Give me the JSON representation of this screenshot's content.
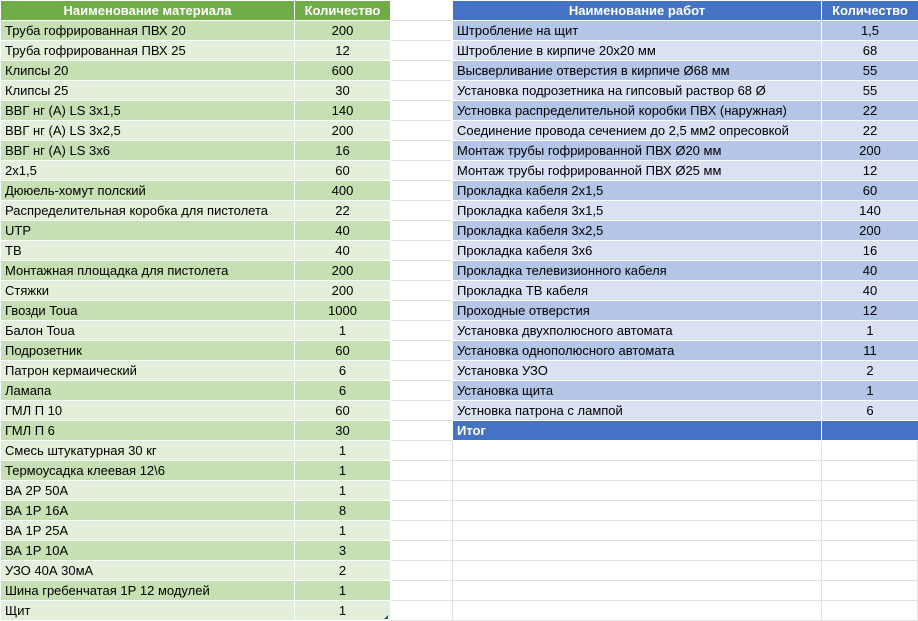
{
  "materials": {
    "headers": {
      "name": "Наименование материала",
      "qty": "Количество"
    },
    "rows": [
      {
        "name": "Труба гофрированная ПВХ 20",
        "qty": "200"
      },
      {
        "name": "Труба гофрированная ПВХ 25",
        "qty": "12"
      },
      {
        "name": "Клипсы 20",
        "qty": "600"
      },
      {
        "name": "Клипсы 25",
        "qty": "30"
      },
      {
        "name": "ВВГ нг (А) LS 3х1,5",
        "qty": "140"
      },
      {
        "name": "ВВГ нг (А) LS 3х2,5",
        "qty": "200"
      },
      {
        "name": "ВВГ нг (А) LS 3х6",
        "qty": "16"
      },
      {
        "name": "2х1,5",
        "qty": "60"
      },
      {
        "name": "Дююель-хомут полский",
        "qty": "400"
      },
      {
        "name": "Распределительная коробка для пистолета",
        "qty": "22"
      },
      {
        "name": "UTP",
        "qty": "40"
      },
      {
        "name": "ТВ",
        "qty": "40"
      },
      {
        "name": "Монтажная площадка для пистолета",
        "qty": "200"
      },
      {
        "name": "Стяжки",
        "qty": "200"
      },
      {
        "name": "Гвозди Toua",
        "qty": "1000"
      },
      {
        "name": "Балон Toua",
        "qty": "1"
      },
      {
        "name": "Подрозетник",
        "qty": "60"
      },
      {
        "name": "Патрон кермаический",
        "qty": "6"
      },
      {
        "name": "Ламапа",
        "qty": "6"
      },
      {
        "name": "ГМЛ П 10",
        "qty": "60"
      },
      {
        "name": "ГМЛ П 6",
        "qty": "30"
      },
      {
        "name": "Смесь штукатурная 30 кг",
        "qty": "1"
      },
      {
        "name": "Термоусадка клеевая 12\\6",
        "qty": "1"
      },
      {
        "name": "ВА 2Р 50А",
        "qty": "1"
      },
      {
        "name": "ВА 1Р 16А",
        "qty": "8"
      },
      {
        "name": "ВА 1Р 25А",
        "qty": "1"
      },
      {
        "name": "ВА 1Р 10А",
        "qty": "3"
      },
      {
        "name": "УЗО 40А 30мА",
        "qty": "2"
      },
      {
        "name": "Шина гребенчатая 1Р 12 модулей",
        "qty": "1"
      },
      {
        "name": "Щит",
        "qty": "1"
      }
    ]
  },
  "works": {
    "headers": {
      "name": "Наименование работ",
      "qty": "Количество"
    },
    "rows": [
      {
        "name": "Штробление на щит",
        "qty": "1,5"
      },
      {
        "name": "Штробление в кирпиче 20х20 мм",
        "qty": "68"
      },
      {
        "name": "Высверливание отверстия в кирпиче Ø68 мм",
        "qty": "55"
      },
      {
        "name": "Установка подрозетника на гипсовый раствор 68 Ø",
        "qty": "55"
      },
      {
        "name": "Устновка распределительной коробки ПВХ (наружная)",
        "qty": "22"
      },
      {
        "name": "Соединение провода сечением до 2,5 мм2 опресовкой",
        "qty": "22"
      },
      {
        "name": "Монтаж трубы гофрированной ПВХ Ø20 мм",
        "qty": "200"
      },
      {
        "name": "Монтаж трубы гофрированной ПВХ Ø25 мм",
        "qty": "12"
      },
      {
        "name": "Прокладка кабеля 2х1,5",
        "qty": "60"
      },
      {
        "name": "Прокладка кабеля 3х1,5",
        "qty": "140"
      },
      {
        "name": "Прокладка кабеля 3х2,5",
        "qty": "200"
      },
      {
        "name": "Прокладка кабеля 3х6",
        "qty": "16"
      },
      {
        "name": "Прокладка телевизионного кабеля",
        "qty": "40"
      },
      {
        "name": "Прокладка ТВ кабеля",
        "qty": "40"
      },
      {
        "name": "Проходные отверстия",
        "qty": "12"
      },
      {
        "name": "Установка двухполюсного автомата",
        "qty": "1"
      },
      {
        "name": "Установка однополюсного автомата",
        "qty": "11"
      },
      {
        "name": "Установка УЗО",
        "qty": "2"
      },
      {
        "name": "Установка щита",
        "qty": "1"
      },
      {
        "name": "Устновка патрона с лампой",
        "qty": "6"
      }
    ],
    "total_label": "Итог",
    "total_value": ""
  }
}
